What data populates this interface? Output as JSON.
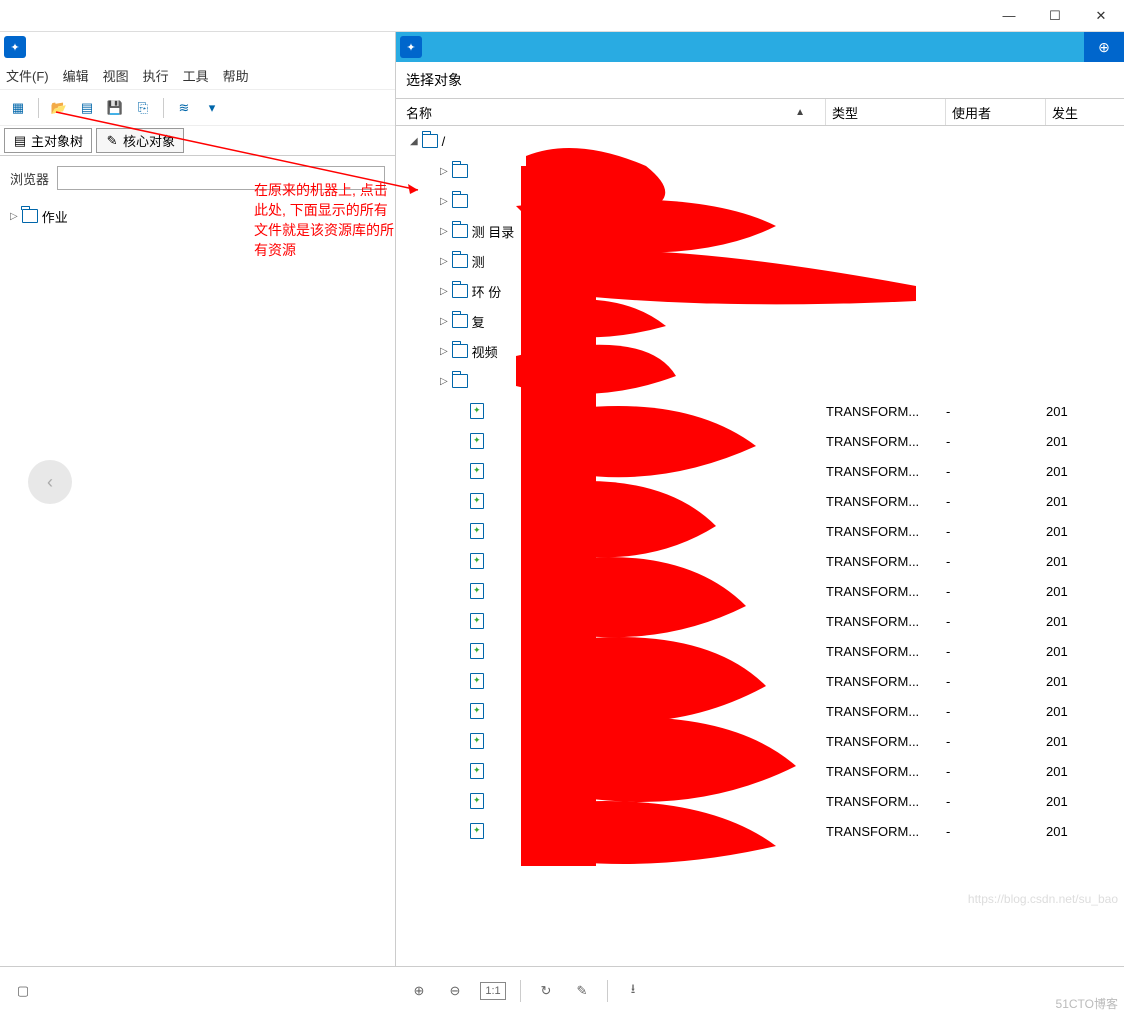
{
  "window_buttons": {
    "min": "—",
    "max": "☐",
    "close": "✕"
  },
  "menu": {
    "file": "文件(F)",
    "edit": "编辑",
    "view": "视图",
    "run": "执行",
    "tools": "工具",
    "help": "帮助"
  },
  "tabs": {
    "main_tree": "主对象树",
    "core": "核心对象"
  },
  "browser": {
    "label": "浏览器",
    "value": ""
  },
  "left_tree": {
    "root": "作业"
  },
  "annotation": "在原来的机器上, 点击此处, 下面显示的所有文件就是该资源库的所有资源",
  "dialog": {
    "title": "选择对象",
    "columns": {
      "name": "名称",
      "type": "类型",
      "user": "使用者",
      "date": "发生"
    },
    "root": "/",
    "folders": [
      "",
      "",
      "测        目录",
      "测",
      "环            份",
      "复",
      "视频",
      ""
    ],
    "file_rows": [
      {
        "type": "TRANSFORM...",
        "user": "-",
        "date": "201"
      },
      {
        "type": "TRANSFORM...",
        "user": "-",
        "date": "201"
      },
      {
        "type": "TRANSFORM...",
        "user": "-",
        "date": "201"
      },
      {
        "type": "TRANSFORM...",
        "user": "-",
        "date": "201"
      },
      {
        "type": "TRANSFORM...",
        "user": "-",
        "date": "201"
      },
      {
        "type": "TRANSFORM...",
        "user": "-",
        "date": "201"
      },
      {
        "type": "TRANSFORM...",
        "user": "-",
        "date": "201"
      },
      {
        "type": "TRANSFORM...",
        "user": "-",
        "date": "201"
      },
      {
        "type": "TRANSFORM...",
        "user": "-",
        "date": "201"
      },
      {
        "type": "TRANSFORM...",
        "user": "-",
        "date": "201"
      },
      {
        "type": "TRANSFORM...",
        "user": "-",
        "date": "201"
      },
      {
        "type": "TRANSFORM...",
        "user": "-",
        "date": "201"
      },
      {
        "type": "TRANSFORM...",
        "user": "-",
        "date": "201"
      },
      {
        "type": "TRANSFORM...",
        "user": "-",
        "date": "201"
      },
      {
        "type": "TRANSFORM...",
        "user": "-",
        "date": "201"
      }
    ]
  },
  "bottombar": {
    "zoom_label": "1:1"
  },
  "watermark": "51CTO博客",
  "watermark2": "https://blog.csdn.net/su_bao"
}
